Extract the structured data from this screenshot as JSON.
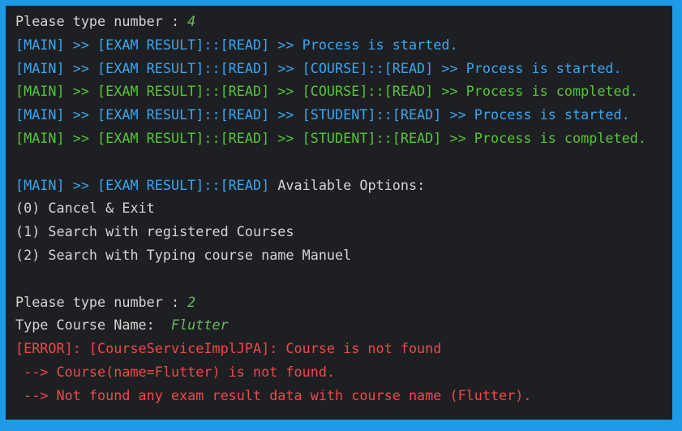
{
  "colors": {
    "background": "#1e1f22",
    "frame": "#1e9be4",
    "default_text": "#d4d4d4",
    "info": "#3aa6f0",
    "success": "#56c43b",
    "error": "#f0484a",
    "input": "#6ab85f"
  },
  "console": {
    "line0": {
      "prompt": "Please type number : ",
      "input": "4"
    },
    "line1": "[MAIN] >> [EXAM RESULT]::[READ] >> Process is started.",
    "line2": "[MAIN] >> [EXAM RESULT]::[READ] >> [COURSE]::[READ] >> Process is started.",
    "line3": "[MAIN] >> [EXAM RESULT]::[READ] >> [COURSE]::[READ] >> Process is completed.",
    "line4": "[MAIN] >> [EXAM RESULT]::[READ] >> [STUDENT]::[READ] >> Process is started.",
    "line5": "[MAIN] >> [EXAM RESULT]::[READ] >> [STUDENT]::[READ] >> Process is completed.",
    "line7": {
      "prefix": "[MAIN] >> [EXAM RESULT]::[READ] ",
      "text": "Available Options:"
    },
    "option0": "(0) Cancel & Exit",
    "option1": "(1) Search with registered Courses",
    "option2": "(2) Search with Typing course name Manuel",
    "line12": {
      "prompt": "Please type number : ",
      "input": "2"
    },
    "line13": {
      "prompt": "Type Course Name:  ",
      "input": "Flutter"
    },
    "error1": "[ERROR]: [CourseServiceImplJPA]: Course is not found",
    "error2": " --> Course(name=Flutter) is not found.",
    "error3": " --> Not found any exam result data with course name (Flutter)."
  }
}
